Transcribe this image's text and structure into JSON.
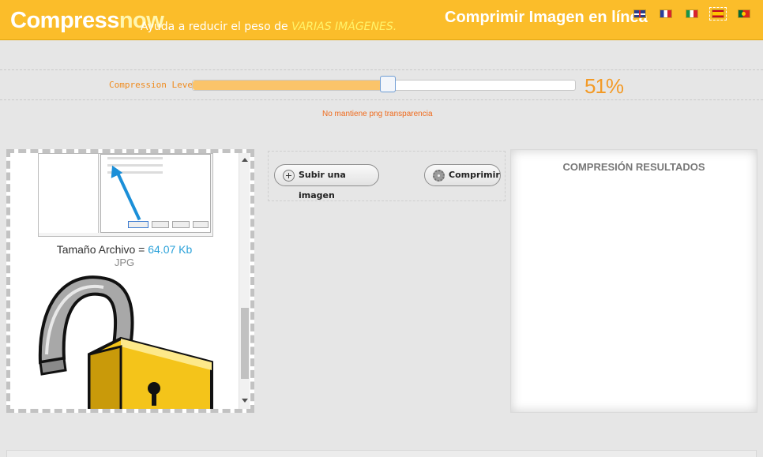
{
  "header": {
    "logo_main": "Compress",
    "logo_accent": "now",
    "tagline_prefix": "Ayuda a reducir el peso de ",
    "tagline_highlight": "VARIAS IMÁGENES.",
    "title": "Comprimir Imagen en línea",
    "flags": [
      "english-flag-icon",
      "french-flag-icon",
      "italian-flag-icon",
      "spanish-flag-icon",
      "portuguese-flag-icon"
    ],
    "active_language": "es"
  },
  "compression": {
    "label": "Compression Level",
    "value": 51,
    "value_text": "51%",
    "note": "No mantiene png transparencia"
  },
  "preview": {
    "size_label": "Tamaño Archivo = ",
    "size_value": "64.07 Kb",
    "file_type": "JPG",
    "images": [
      "dialog-screenshot-thumbnail",
      "padlock-image"
    ]
  },
  "actions": {
    "upload_label": "Subir una imagen",
    "compress_label": "Comprimir"
  },
  "results": {
    "title": "COMPRESIÓN RESULTADOS"
  },
  "colors": {
    "header_bg": "#fbbd2a",
    "accent_orange": "#f39a26",
    "link_blue": "#2aa1d9",
    "slider_fill": "#fbc46a"
  }
}
